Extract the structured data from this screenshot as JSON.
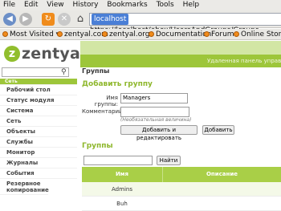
{
  "browser": {
    "menu": [
      "File",
      "Edit",
      "View",
      "History",
      "Bookmarks",
      "Tools",
      "Help"
    ],
    "site_identity": "localhost",
    "url": "https://localhost/ebox/UsersAndGroups/Groups",
    "bookmarks": [
      "Most Visited ▾",
      "zentyal.com",
      "zentyal.org",
      "Documentation",
      "Forum",
      "Online Store"
    ]
  },
  "header": {
    "logo_text": "zentyal",
    "tagline": "Удаленная панель управле"
  },
  "sidebar": {
    "search_placeholder": "",
    "items": [
      {
        "label": "Сеть"
      },
      {
        "label": "Рабочий стол"
      },
      {
        "label": "Статус модуля"
      },
      {
        "label": "Система"
      },
      {
        "label": "Сеть"
      },
      {
        "label": "Объекты"
      },
      {
        "label": "Службы"
      },
      {
        "label": "Монитор"
      },
      {
        "label": "Журналы"
      },
      {
        "label": "События"
      },
      {
        "label": "Резервное копирование"
      }
    ]
  },
  "main": {
    "page_title": "Группы",
    "add_section_title": "Добавить группу",
    "name_label": "Имя группы:",
    "name_value": "Managers",
    "comment_label": "Комментарий:",
    "comment_value": "",
    "comment_hint": "(Необязательная величина)",
    "add_edit_button": "Добавить и редактировать",
    "add_button": "Добавить",
    "groups_section_title": "Группы",
    "search_value": "",
    "go_button": "Найти",
    "table": {
      "columns": [
        "Имя",
        "Описание"
      ],
      "rows": [
        {
          "name": "Admins",
          "description": ""
        },
        {
          "name": "Buh",
          "description": ""
        }
      ]
    }
  },
  "colors": {
    "brand_green": "#9dc63a",
    "section_green": "#8eb72c",
    "header_light": "#d2e6a4"
  }
}
